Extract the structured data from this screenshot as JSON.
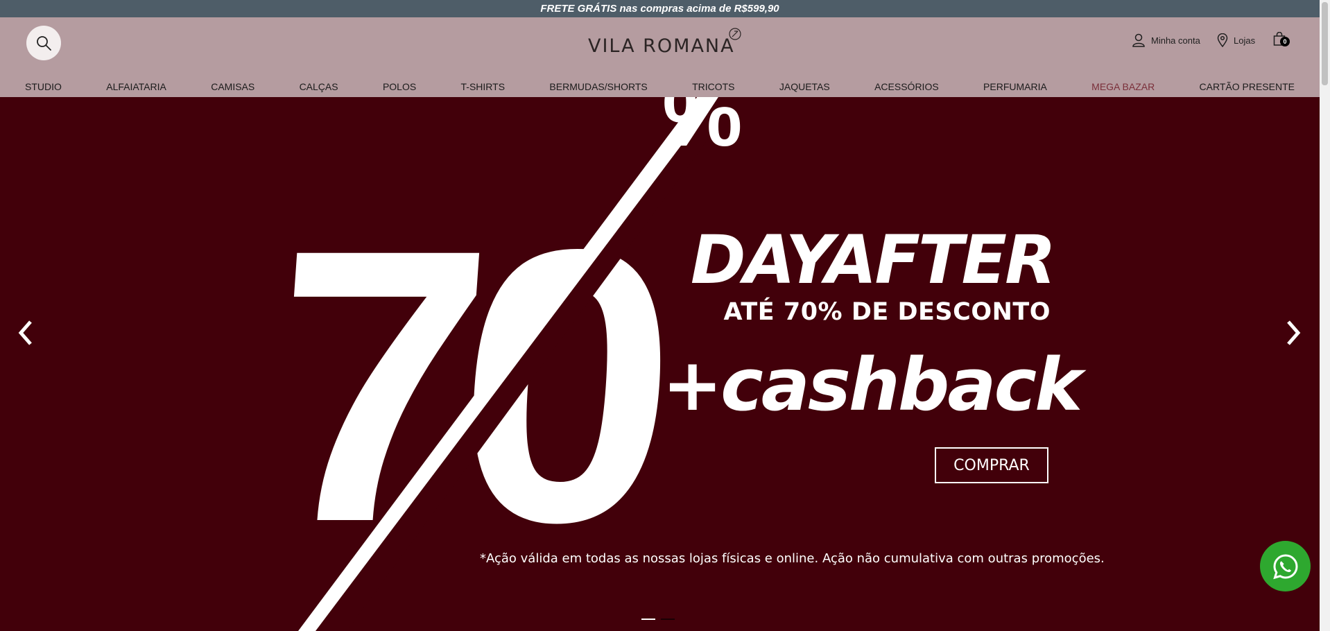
{
  "promo_bar": {
    "text": "FRETE GRÁTIS nas compras acima de R$599,90"
  },
  "header": {
    "logo_text": "VILA ROMANA",
    "account_label": "Minha conta",
    "stores_label": "Lojas",
    "cart_count": "0"
  },
  "nav": {
    "items": [
      "STUDIO",
      "ALFAIATARIA",
      "CAMISAS",
      "CALÇAS",
      "POLOS",
      "T-SHIRTS",
      "BERMUDAS/SHORTS",
      "TRICOTS",
      "JAQUETAS",
      "ACESSÓRIOS",
      "PERFUMARIA",
      "MEGA BAZAR",
      "CARTÃO PRESENTE"
    ],
    "highlight_color": "#7a2f3a"
  },
  "hero": {
    "big_number": "70",
    "percent_sign": "%",
    "headline": "DAYAFTER",
    "subhead": "ATÉ 70% DE DESCONTO",
    "cashback": "+cashback",
    "button_label": "COMPRAR",
    "disclaimer": "*Ação válida em todas as nossas lojas físicas e online. Ação não cumulativa com outras promoções.",
    "slide_count": 2,
    "active_slide": 1
  },
  "colors": {
    "promo_bar": "#4e5d68",
    "header": "#b59ca0",
    "hero_bg": "#42000a",
    "whatsapp": "#2ea82f"
  }
}
